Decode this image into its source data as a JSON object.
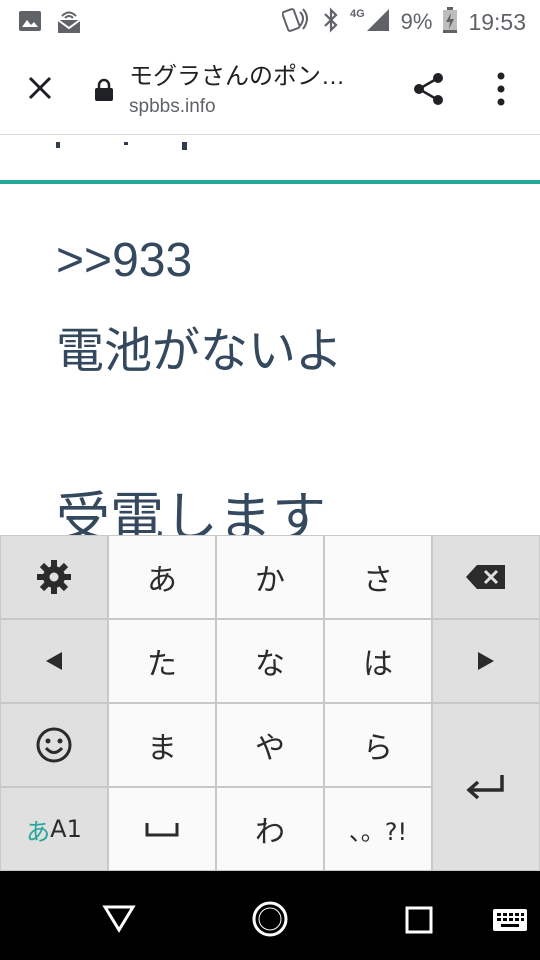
{
  "status_bar": {
    "network_label": "4G",
    "battery_percent": "9%",
    "time": "19:53"
  },
  "toolbar": {
    "title": "モグラさんのポン…",
    "url": "spbbs.info"
  },
  "content": {
    "reply_ref": ">>933",
    "message_line1": "電池がないよ",
    "message_line2": "受電します"
  },
  "keyboard": {
    "rows": [
      [
        "あ",
        "か",
        "さ"
      ],
      [
        "た",
        "な",
        "は"
      ],
      [
        "ま",
        "や",
        "ら"
      ],
      [
        "わ",
        "、。?!"
      ]
    ],
    "mode_kana": "あ",
    "mode_alpha": "A1"
  },
  "colors": {
    "accent_teal": "#26a69a",
    "text_main": "#34485e",
    "status_icon": "#5f6368",
    "nav_bg": "#000000"
  }
}
